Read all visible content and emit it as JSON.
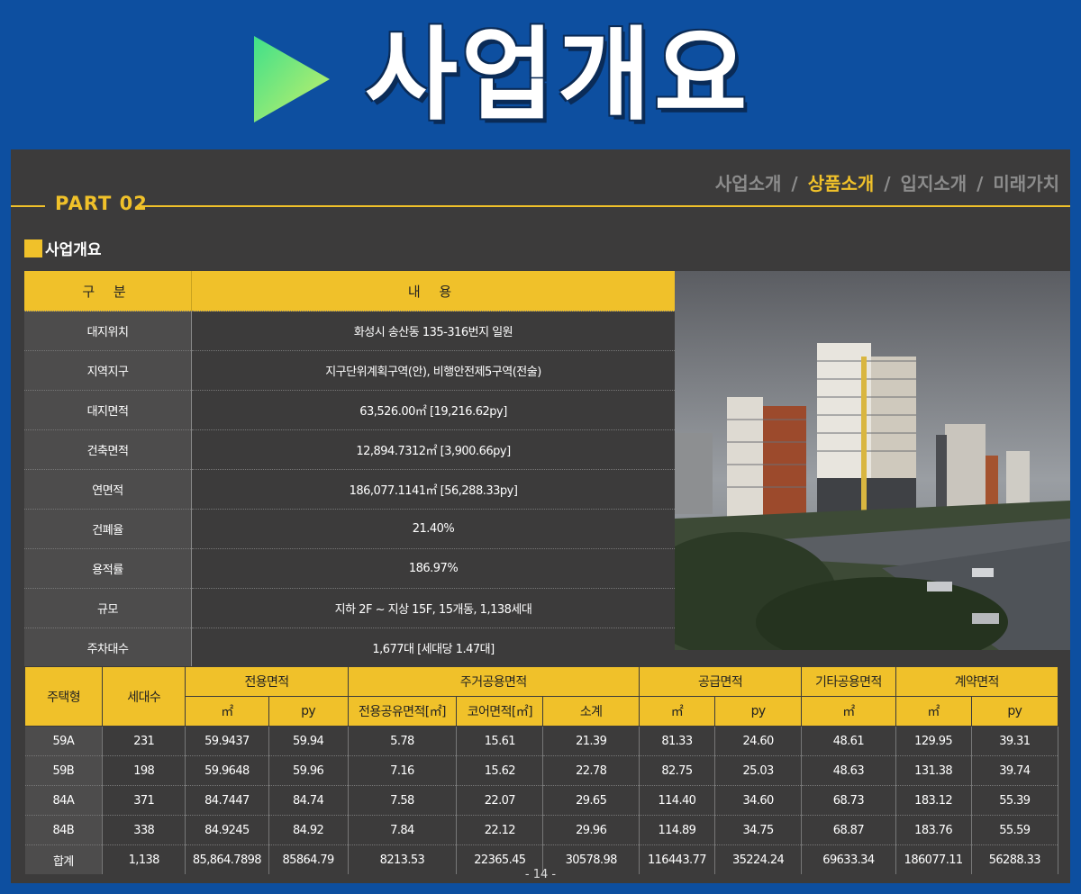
{
  "banner": {
    "title": "사업개요",
    "icon": "play-triangle-icon"
  },
  "nav": {
    "items": [
      "사업소개",
      "상품소개",
      "입지소개",
      "미래가치"
    ],
    "separator": " / ",
    "active_index": 1
  },
  "part_label": "PART 02",
  "section_title": "사업개요",
  "overview": {
    "headers": [
      "구 분",
      "내 용"
    ],
    "rows": [
      {
        "key": "대지위치",
        "value": "화성시 송산동 135-316번지 일원"
      },
      {
        "key": "지역지구",
        "value": "지구단위계획구역(안), 비행안전제5구역(전술)"
      },
      {
        "key": "대지면적",
        "value": "63,526.00㎡ [19,216.62py]"
      },
      {
        "key": "건축면적",
        "value": "12,894.7312㎡ [3,900.66py]"
      },
      {
        "key": "연면적",
        "value": "186,077.1141㎡ [56,288.33py]"
      },
      {
        "key": "건폐율",
        "value": "21.40%"
      },
      {
        "key": "용적률",
        "value": "186.97%"
      },
      {
        "key": "규모",
        "value": "지하 2F ~ 지상 15F, 15개동, 1,138세대"
      },
      {
        "key": "주차대수",
        "value": "1,677대 [세대당 1.47대]"
      }
    ]
  },
  "units": {
    "header_top": [
      "주택형",
      "세대수",
      "전용면적",
      "주거공용면적",
      "공급면적",
      "기타공용면적",
      "계약면적"
    ],
    "header_sub": [
      "㎡",
      "py",
      "전용공유면적[㎡]",
      "코어면적[㎡]",
      "소계",
      "㎡",
      "py",
      "㎡",
      "㎡",
      "py"
    ],
    "rows": [
      [
        "59A",
        "231",
        "59.9437",
        "59.94",
        "5.78",
        "15.61",
        "21.39",
        "81.33",
        "24.60",
        "48.61",
        "129.95",
        "39.31"
      ],
      [
        "59B",
        "198",
        "59.9648",
        "59.96",
        "7.16",
        "15.62",
        "22.78",
        "82.75",
        "25.03",
        "48.63",
        "131.38",
        "39.74"
      ],
      [
        "84A",
        "371",
        "84.7447",
        "84.74",
        "7.58",
        "22.07",
        "29.65",
        "114.40",
        "34.60",
        "68.73",
        "183.12",
        "55.39"
      ],
      [
        "84B",
        "338",
        "84.9245",
        "84.92",
        "7.84",
        "22.12",
        "29.96",
        "114.89",
        "34.75",
        "68.87",
        "183.76",
        "55.59"
      ],
      [
        "합계",
        "1,138",
        "85,864.7898",
        "85864.79",
        "8213.53",
        "22365.45",
        "30578.98",
        "116443.77",
        "35224.24",
        "69633.34",
        "186077.11",
        "56288.33"
      ]
    ]
  },
  "page_number": "- 14 -",
  "colors": {
    "background": "#0d4fa0",
    "panel": "#3c3b3b",
    "accent": "#f0c12a"
  }
}
